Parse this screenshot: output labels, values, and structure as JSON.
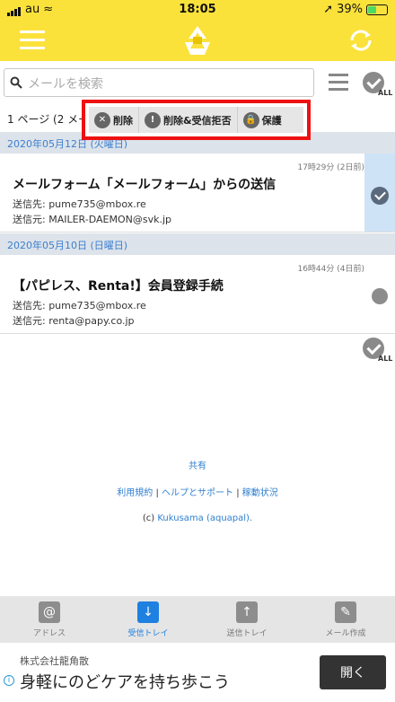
{
  "status": {
    "carrier": "au",
    "time": "18:05",
    "battery": "39%"
  },
  "search": {
    "placeholder": "メールを検索"
  },
  "allLabel": "ALL",
  "pageInfo": "1 ページ (2 メー",
  "actions": {
    "delete": "削除",
    "delete_block": "削除&受信拒否",
    "protect": "保護"
  },
  "groups": [
    {
      "date": "2020年05月12日 (火曜日)",
      "mail": {
        "time": "17時29分 (2日前)",
        "subject": "メールフォーム「メールフォーム」からの送信",
        "to": "送信先: pume735@mbox.re",
        "from": "送信元: MAILER-DAEMON@svk.jp"
      }
    },
    {
      "date": "2020年05月10日 (日曜日)",
      "mail": {
        "time": "16時44分 (4日前)",
        "subject": "【パピレス、Renta!】会員登録手続",
        "to": "送信先: pume735@mbox.re",
        "from": "送信元: renta@papy.co.jp"
      }
    }
  ],
  "footer": {
    "share": "共有",
    "terms": "利用規約",
    "help": "ヘルプとサポート",
    "status": "稼動状況",
    "copy_prefix": "(c) ",
    "copy_name": "Kukusama (aquapal)."
  },
  "tabs": [
    {
      "label": "アドレス",
      "icon": "@"
    },
    {
      "label": "受信トレイ",
      "icon": "↓"
    },
    {
      "label": "送信トレイ",
      "icon": "↑"
    },
    {
      "label": "メール作成",
      "icon": "✎"
    }
  ],
  "ad": {
    "advertiser": "株式会社龍角散",
    "title": "身軽にのどケアを持ち歩こう",
    "button": "開く"
  },
  "colors": {
    "accent": "#fbe23b",
    "highlight": "#e11111",
    "link": "#2f7fd0"
  }
}
